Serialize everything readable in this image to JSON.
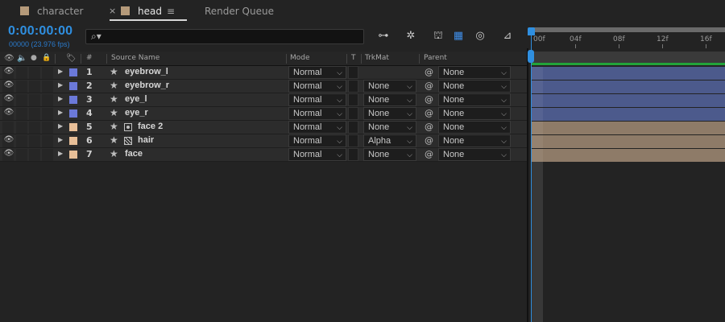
{
  "tabs": [
    {
      "label": "character",
      "active": false
    },
    {
      "label": "head",
      "active": true
    },
    {
      "label": "Render Queue",
      "active": false
    }
  ],
  "tab_close_glyph": "×",
  "tab_menu_glyph": "≡",
  "timecode": "0:00:00:00",
  "fps": "00000 (23.976 fps)",
  "search": {
    "value": "",
    "icon": "search-icon"
  },
  "toolbar_icons": [
    "composition-mini-flowchart-icon",
    "draft-3d-icon",
    "hide-shy-layers-icon",
    "frame-blending-icon",
    "motion-blur-icon",
    "graph-editor-icon"
  ],
  "ruler": {
    "labels": [
      "00f",
      "04f",
      "08f",
      "12f",
      "16f"
    ]
  },
  "columns": {
    "hash": "#",
    "source_name": "Source Name",
    "mode": "Mode",
    "t": "T",
    "trkmat": "TrkMat",
    "parent": "Parent"
  },
  "layers": [
    {
      "num": "1",
      "name": "eyebrow_l",
      "mode": "Normal",
      "trkmat": "",
      "parent": "None",
      "label_color": "#6b79d9",
      "visible": true,
      "icon": ""
    },
    {
      "num": "2",
      "name": "eyebrow_r",
      "mode": "Normal",
      "trkmat": "None",
      "parent": "None",
      "label_color": "#6b79d9",
      "visible": true,
      "icon": ""
    },
    {
      "num": "3",
      "name": "eye_l",
      "mode": "Normal",
      "trkmat": "None",
      "parent": "None",
      "label_color": "#6b79d9",
      "visible": true,
      "icon": ""
    },
    {
      "num": "4",
      "name": "eye_r",
      "mode": "Normal",
      "trkmat": "None",
      "parent": "None",
      "label_color": "#6b79d9",
      "visible": true,
      "icon": ""
    },
    {
      "num": "5",
      "name": "face 2",
      "mode": "Normal",
      "trkmat": "None",
      "parent": "None",
      "label_color": "#e8bf98",
      "visible": false,
      "icon": "composition-icon"
    },
    {
      "num": "6",
      "name": "hair",
      "mode": "Normal",
      "trkmat": "Alpha",
      "parent": "None",
      "label_color": "#e8bf98",
      "visible": true,
      "icon": "footage-icon"
    },
    {
      "num": "7",
      "name": "face",
      "mode": "Normal",
      "trkmat": "None",
      "parent": "None",
      "label_color": "#e8bf98",
      "visible": true,
      "icon": ""
    }
  ],
  "colors": {
    "accent": "#2f8fe0",
    "bar_blue": "#4c5a8c",
    "bar_tan": "#8e7b68",
    "work_area_green": "#22a33a"
  }
}
